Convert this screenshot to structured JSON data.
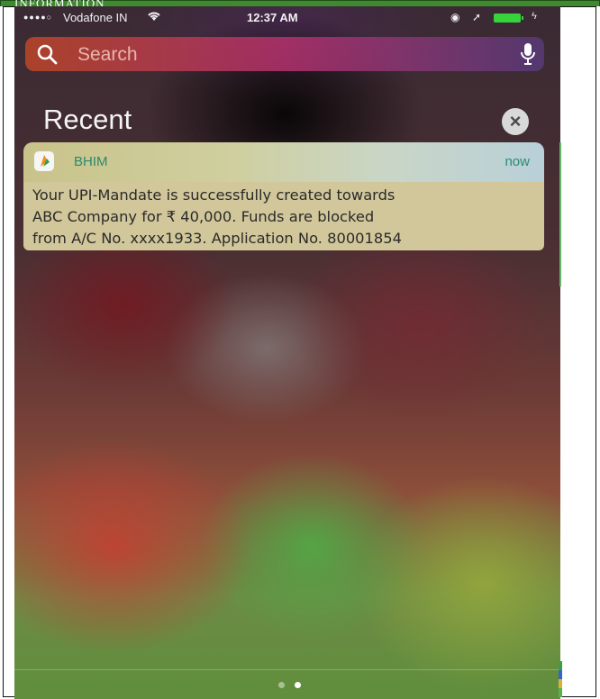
{
  "doc": {
    "top_text": "INFORMATION"
  },
  "status_bar": {
    "signal_dots": "●●●●○",
    "carrier": "Vodafone IN",
    "time": "12:37 AM"
  },
  "search": {
    "placeholder": "Search"
  },
  "notifications": {
    "section_title": "Recent",
    "items": [
      {
        "app": "BHIM",
        "time": "now",
        "lines": [
          "Your UPI-Mandate is successfully created towards",
          "ABC Company for ₹ 40,000. Funds are blocked",
          "from A/C No. xxxx1933. Application No. 80001854"
        ]
      }
    ]
  },
  "page_indicator": {
    "count": 2,
    "active": 2
  },
  "colors": {
    "accent_green": "#2a8a6f",
    "card_body": "#d2c79a",
    "battery": "#36d33a"
  }
}
